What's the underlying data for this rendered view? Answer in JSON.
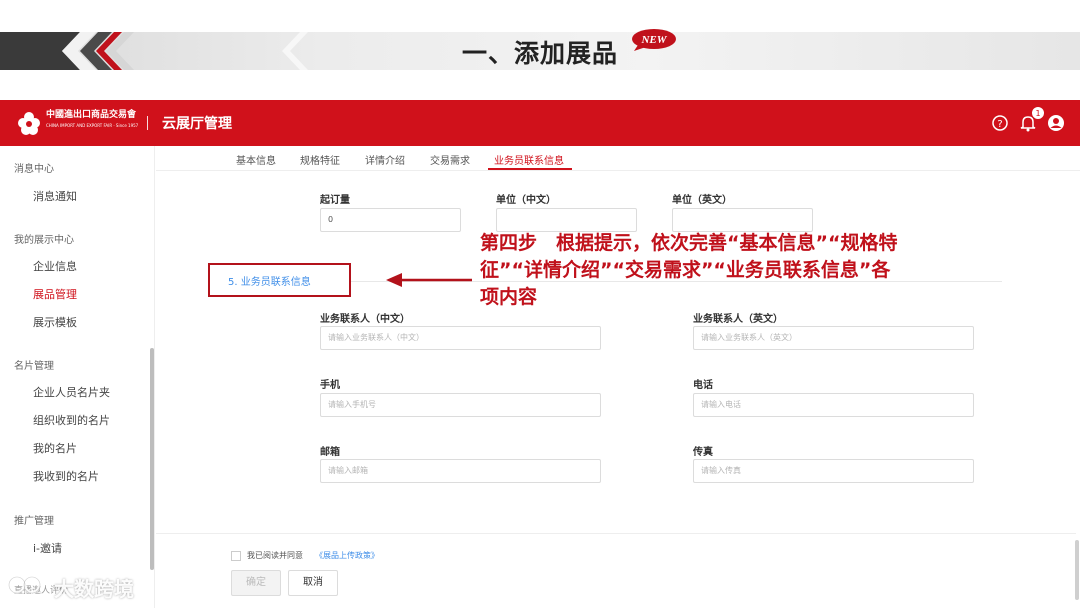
{
  "slide": {
    "title": "一、添加展品",
    "badge": "NEW"
  },
  "header": {
    "logo_text": "中國進出口商品交易會",
    "logo_sub": "CHINA IMPORT AND EXPORT FAIR · Since 1957",
    "app_title": "云展厅管理",
    "notification_count": "1",
    "accent_color": "#d0111b"
  },
  "sidebar": {
    "groups": [
      {
        "label": "消息中心",
        "items": [
          "消息通知"
        ]
      },
      {
        "label": "我的展示中心",
        "items": [
          "企业信息",
          "展品管理",
          "展示模板"
        ]
      },
      {
        "label": "名片管理",
        "items": [
          "企业人员名片夹",
          "组织收到的名片",
          "我的名片",
          "我收到的名片"
        ]
      },
      {
        "label": "推广管理",
        "items": [
          "i-邀请",
          "直播邀人评价"
        ]
      }
    ],
    "active_item": "展品管理"
  },
  "tabs": [
    "基本信息",
    "规格特征",
    "详情介绍",
    "交易需求",
    "业务员联系信息"
  ],
  "active_tab": "业务员联系信息",
  "order_fields": {
    "min_order_label": "起订量",
    "min_order_value": "0",
    "unit_cn_label": "单位（中文）",
    "unit_en_label": "单位（英文）"
  },
  "section": {
    "label": "5. 业务员联系信息"
  },
  "callout": "第四步　根据提示，依次完善“基本信息”“规格特征”“详情介绍”“交易需求”“业务员联系信息”各项内容",
  "contact": {
    "name_cn_label": "业务联系人（中文）",
    "name_cn_placeholder": "请输入业务联系人（中文）",
    "name_en_label": "业务联系人（英文）",
    "name_en_placeholder": "请输入业务联系人（英文）",
    "mobile_label": "手机",
    "mobile_placeholder": "请输入手机号",
    "phone_label": "电话",
    "phone_placeholder": "请输入电话",
    "email_label": "邮箱",
    "email_placeholder": "请输入邮箱",
    "fax_label": "传真",
    "fax_placeholder": "请输入传真"
  },
  "footer": {
    "agree_text": "我已阅读并同意",
    "agree_link": "《展品上传政策》",
    "confirm_label": "确定",
    "cancel_label": "取消"
  },
  "watermark": "大数跨境"
}
